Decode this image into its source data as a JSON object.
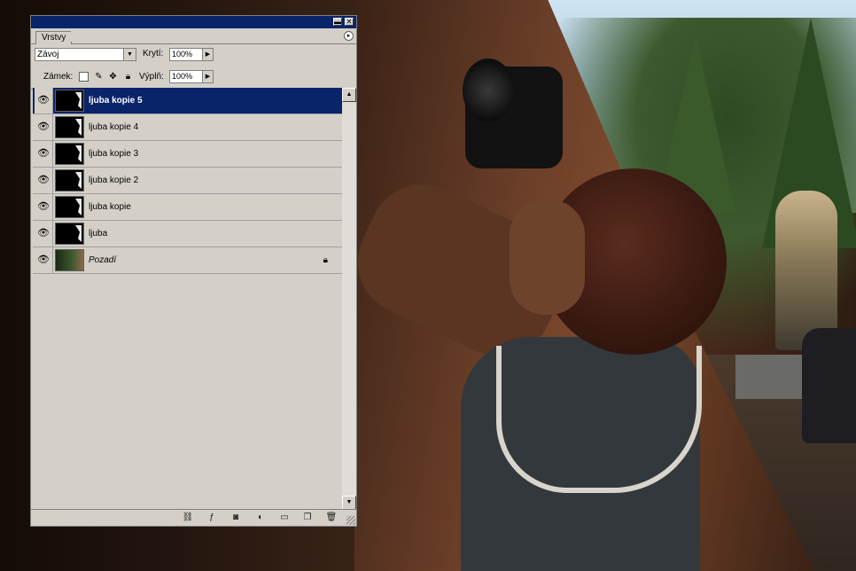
{
  "panel": {
    "tab_label": "Vrstvy",
    "blend_mode": "Závoj",
    "opacity_label": "Krytí:",
    "opacity_value": "100%",
    "lock_label": "Zámek:",
    "fill_label": "Výplň:",
    "fill_value": "100%"
  },
  "layers": [
    {
      "name": "ljuba kopie 5",
      "active": true
    },
    {
      "name": "ljuba kopie 4",
      "active": false
    },
    {
      "name": "ljuba kopie 3",
      "active": false
    },
    {
      "name": "ljuba kopie 2",
      "active": false
    },
    {
      "name": "ljuba kopie",
      "active": false
    },
    {
      "name": "ljuba",
      "active": false
    },
    {
      "name": "Pozadí",
      "active": false,
      "locked": true
    }
  ],
  "colors": {
    "titlebar": "#0a246a",
    "panel_bg": "#d4d0c8",
    "selection": "#0a246a"
  },
  "icons": {
    "visibility": "eye-icon",
    "lock": "lock-icon",
    "bottom": [
      "link-icon",
      "layer-style-icon",
      "mask-icon",
      "adjustment-layer-icon",
      "new-group-icon",
      "new-layer-icon",
      "trash-icon"
    ]
  }
}
